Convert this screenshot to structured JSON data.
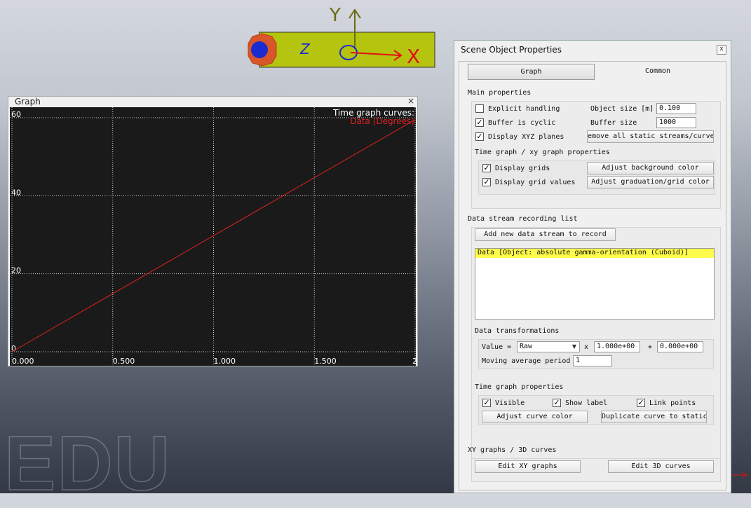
{
  "scene": {
    "y_label": "Y",
    "z_label": "Z",
    "x_label": "X"
  },
  "graph_window": {
    "title": "Graph",
    "close": "×",
    "legend_title": "Time graph curves:",
    "background": "#1a1a1a",
    "curve_color": "#e02020"
  },
  "chart_data": {
    "type": "line",
    "x_ticks": [
      "0.000",
      "0.500",
      "1.000",
      "1.500",
      "2"
    ],
    "y_ticks": [
      "0",
      "20",
      "40",
      "60"
    ],
    "xlim": [
      0,
      2
    ],
    "ylim": [
      0,
      60
    ],
    "grid": true,
    "legend_position": "top-right",
    "series": [
      {
        "name": "Data (Degrees)",
        "x": [
          0,
          2
        ],
        "y": [
          0,
          59.5
        ]
      }
    ]
  },
  "props": {
    "title": "Scene Object Properties",
    "close": "x",
    "tabs": [
      "Graph",
      "Common"
    ],
    "main": {
      "heading": "Main properties",
      "explicit_handling": "Explicit handling",
      "buffer_cyclic": "Buffer is cyclic",
      "display_planes": "Display XYZ planes",
      "object_size_label": "Object size [m]",
      "object_size_value": "0.100",
      "buffer_size_label": "Buffer size",
      "buffer_size_value": "1000",
      "remove_button": "emove all static streams/curve",
      "time_graph_heading": "Time graph / xy graph properties",
      "display_grids": "Display grids",
      "display_grid_values": "Display grid values",
      "adjust_bg": "Adjust background color",
      "adjust_grad": "Adjust graduation/grid color"
    },
    "stream": {
      "heading": "Data stream recording list",
      "add_button": "Add new data stream to record",
      "items": [
        "Data [Object: absolute gamma-orientation (Cuboid)]"
      ],
      "transformations_heading": "Data transformations",
      "value_label": "Value =",
      "value_select": "Raw",
      "times": "x",
      "multiplier": "1.000e+00",
      "plus": "+",
      "offset": "0.000e+00",
      "moving_avg_label": "Moving average period",
      "moving_avg_value": "1",
      "time_graph_props_heading": "Time graph properties",
      "visible": "Visible",
      "show_label": "Show label",
      "link_points": "Link points",
      "adjust_curve_color": "Adjust curve color",
      "duplicate_curve": "Duplicate curve to static"
    },
    "xy": {
      "heading": "XY graphs / 3D curves",
      "edit_xy": "Edit XY graphs",
      "edit_3d": "Edit 3D curves"
    }
  }
}
